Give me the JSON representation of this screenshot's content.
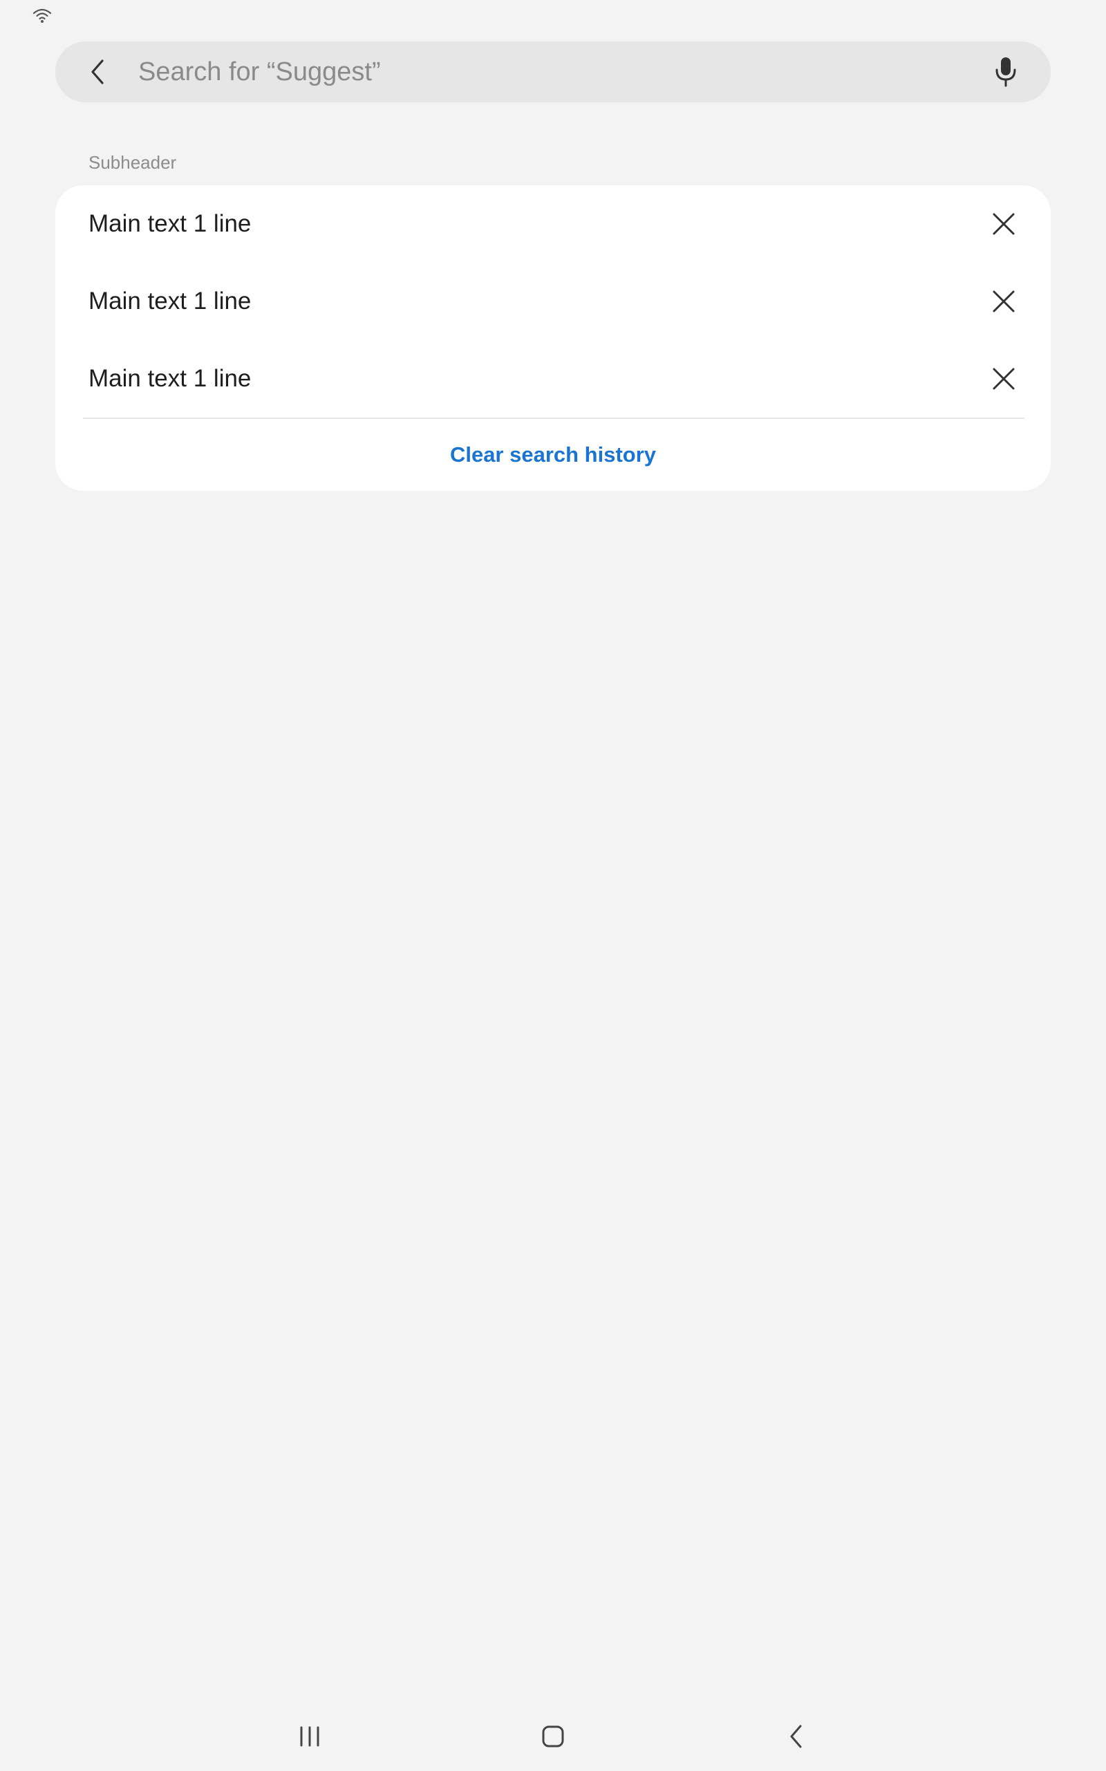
{
  "search": {
    "placeholder": "Search for “Suggest”"
  },
  "history": {
    "subheader": "Subheader",
    "items": [
      {
        "label": "Main text 1 line"
      },
      {
        "label": "Main text 1 line"
      },
      {
        "label": "Main text 1 line"
      }
    ],
    "clear_label": "Clear search history"
  },
  "icons": {
    "status": "wifi-icon",
    "back": "chevron-left-icon",
    "mic": "microphone-icon",
    "remove": "close-icon",
    "nav_recents": "recent-apps-icon",
    "nav_home": "home-icon",
    "nav_back": "back-icon"
  },
  "colors": {
    "background": "#f3f3f3",
    "search_bar": "#e6e6e6",
    "card": "#ffffff",
    "accent": "#1a75d2",
    "primary_text": "#1e1e1e",
    "secondary_text": "#8c8c8c"
  }
}
